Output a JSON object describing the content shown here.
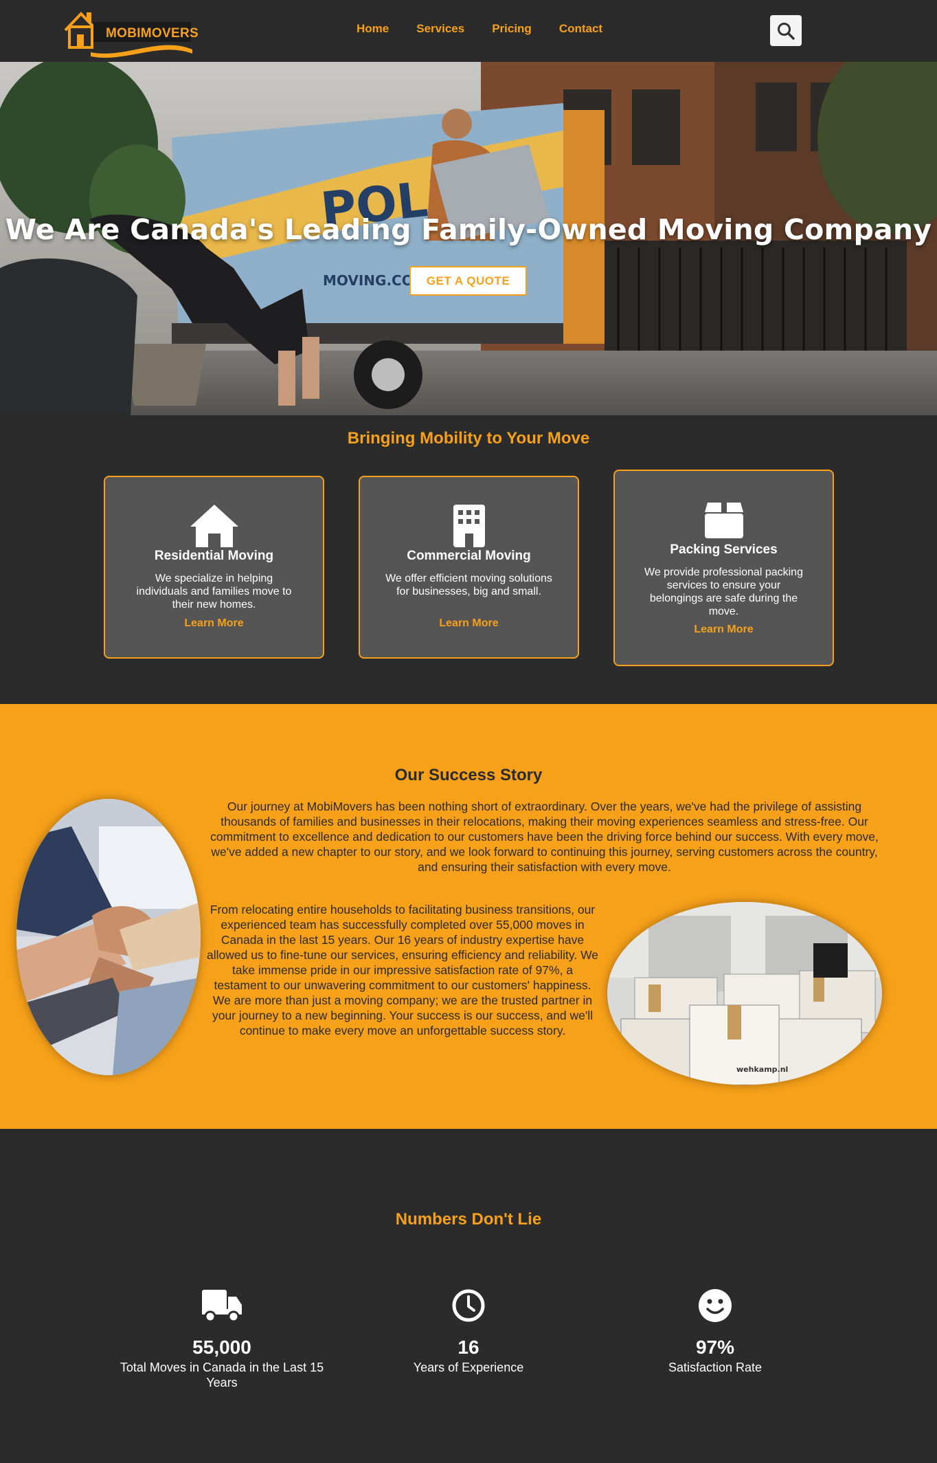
{
  "brand": {
    "name": "MOBIMOVERS",
    "accent": "#f7a11a",
    "dark": "#2b2b2b"
  },
  "nav": {
    "links": [
      "Home",
      "Services",
      "Pricing",
      "Contact"
    ],
    "search_icon": "search-icon"
  },
  "hero": {
    "title": "We Are Canada's Leading Family-Owned Moving Company",
    "cta": "GET A QUOTE",
    "truck_text": "MOVING.COM"
  },
  "services": {
    "title": "Bringing Mobility to Your Move",
    "cards": [
      {
        "icon": "house-icon",
        "title": "Residential Moving",
        "desc": "We specialize in helping individuals and families move to their new homes.",
        "link": "Learn More"
      },
      {
        "icon": "building-icon",
        "title": "Commercial Moving",
        "desc": "We offer efficient moving solutions for businesses, big and small.",
        "link": "Learn More"
      },
      {
        "icon": "box-icon",
        "title": "Packing Services",
        "desc": "We provide professional packing services to ensure your belongings are safe during the move.",
        "link": "Learn More"
      }
    ]
  },
  "story": {
    "title": "Our Success Story",
    "p1": "Our journey at MobiMovers has been nothing short of extraordinary. Over the years, we've had the privilege of assisting thousands of families and businesses in their relocations, making their moving experiences seamless and stress-free. Our commitment to excellence and dedication to our customers have been the driving force behind our success. With every move, we've added a new chapter to our story, and we look forward to continuing this journey, serving customers across the country, and ensuring their satisfaction with every move.",
    "p2": "From relocating entire households to facilitating business transitions, our experienced team has successfully completed over 55,000 moves in Canada in the last 15 years. Our 16 years of industry expertise have allowed us to fine-tune our services, ensuring efficiency and reliability. We take immense pride in our impressive satisfaction rate of 97%, a testament to our unwavering commitment to our customers' happiness. We are more than just a moving company; we are the trusted partner in your journey to a new beginning. Your success is our success, and we'll continue to make every move an unforgettable success story.",
    "box_label": "wehkamp.nl"
  },
  "numbers": {
    "title": "Numbers Don't Lie",
    "stats": [
      {
        "icon": "truck-icon",
        "value": "55,000",
        "label": "Total Moves in Canada in the Last 15 Years"
      },
      {
        "icon": "clock-icon",
        "value": "16",
        "label": "Years of Experience"
      },
      {
        "icon": "smile-icon",
        "value": "97%",
        "label": "Satisfaction Rate"
      }
    ]
  }
}
